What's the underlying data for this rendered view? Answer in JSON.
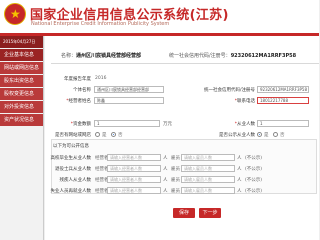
{
  "header": {
    "title": "国家企业信用信息公示系统(江苏)",
    "subtitle": "National Enterprise Credit Information Publicity System"
  },
  "sidebar": {
    "date": "2015年04月27日",
    "items": [
      {
        "label": "企业基本信息"
      },
      {
        "label": "网站或网店信息"
      },
      {
        "label": "股东出资信息"
      },
      {
        "label": "股权变更信息"
      },
      {
        "label": "对外投资信息"
      },
      {
        "label": "资产状况信息"
      }
    ]
  },
  "title_bar": {
    "name_label": "名称：",
    "name_value": "通州区川宸锁具经营部经营部",
    "code_label": "统一社会信用代码/注册号：",
    "code_value": "92320612MA1RRF3P58"
  },
  "form": {
    "year_label": "年度报告年度",
    "year_value": "2016",
    "company_label": "个体名称",
    "company_value": "通州区川宸锁具经营部经营部",
    "uscc_label": "统一社会信用代码/注册号",
    "uscc_value": "92320612MA1RRF3P58",
    "operator_label": "经营者姓名",
    "operator_value": "陈鑫",
    "phone_label": "联系电话",
    "phone_value": "18012217788",
    "capital_label": "资金数额",
    "capital_value": "1",
    "capital_unit": "万元",
    "employees_label": "从业人数",
    "employees_value": "1",
    "website_label": "是否有网站或网店",
    "option_yes": "是",
    "option_no": "否",
    "public_label": "是否公示从业人数",
    "public_yes": "是",
    "public_no": "否"
  },
  "section": {
    "title": "以下为可公开信息",
    "rows": [
      {
        "label": "高校毕业生从业人数",
        "op_label": "经营者",
        "emp_label": "雇员",
        "op_placeholder": "请输入经营者人数",
        "emp_placeholder": "请输入雇员人数",
        "unit": "人",
        "note": "(不公示)"
      },
      {
        "label": "退役士兵从业人数",
        "op_label": "经营者",
        "emp_label": "雇员",
        "op_placeholder": "请输入经营者人数",
        "emp_placeholder": "请输入雇员人数",
        "unit": "人",
        "note": "(不公示)"
      },
      {
        "label": "残疾人从业人数",
        "op_label": "经营者",
        "emp_label": "雇员",
        "op_placeholder": "请输入经营者人数",
        "emp_placeholder": "请输入雇员人数",
        "unit": "人",
        "note": "(不公示)"
      },
      {
        "label": "失业人员再就业人数",
        "op_label": "经营者",
        "emp_label": "雇员",
        "op_placeholder": "请输入经营者人数",
        "emp_placeholder": "请输入雇员人数",
        "unit": "人",
        "note": "(不公示)"
      }
    ]
  },
  "buttons": {
    "save": "保存",
    "next": "下一步"
  },
  "colors": {
    "brand": "#c62828",
    "sidebar": "#b93a3a"
  }
}
